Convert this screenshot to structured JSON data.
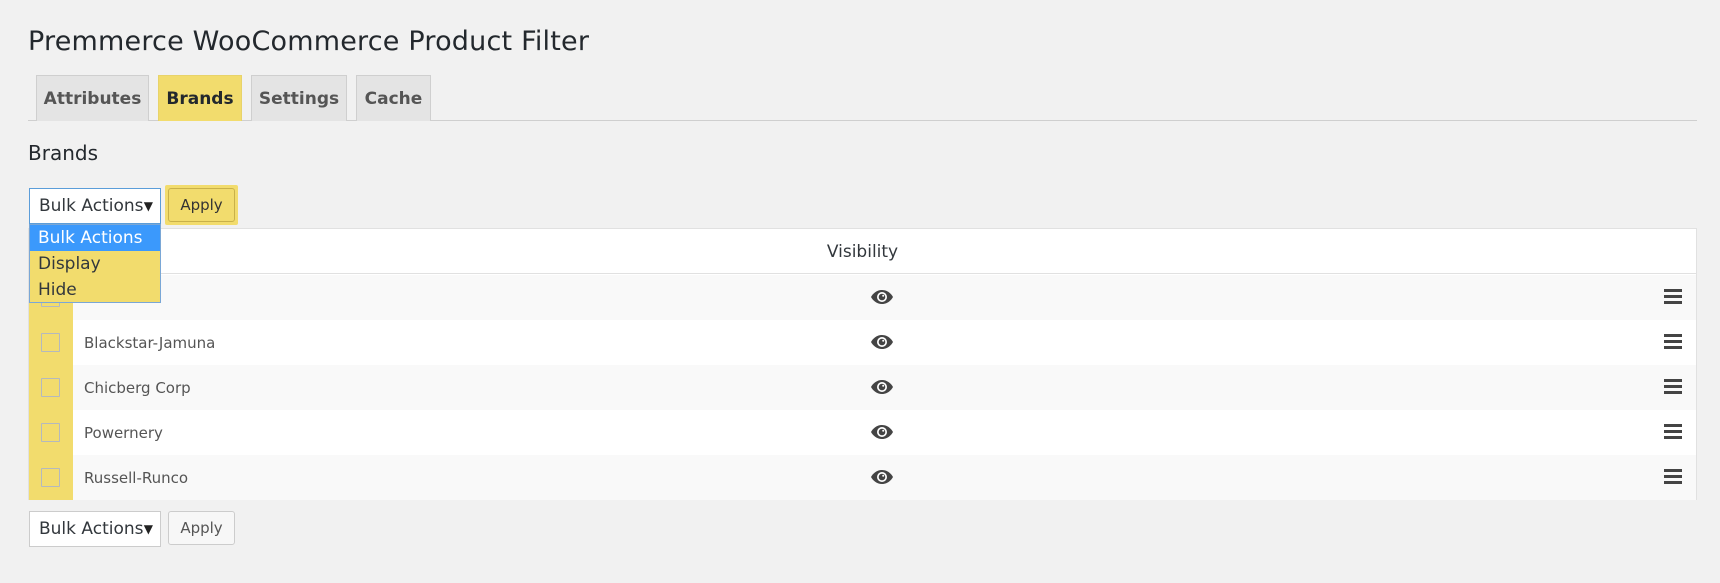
{
  "page": {
    "title": "Premmerce WooCommerce Product Filter"
  },
  "tabs": [
    {
      "label": "Attributes",
      "active": false
    },
    {
      "label": "Brands",
      "active": true
    },
    {
      "label": "Settings",
      "active": false
    },
    {
      "label": "Cache",
      "active": false
    }
  ],
  "section": {
    "title": "Brands"
  },
  "bulk_top": {
    "selected": "Bulk Actions",
    "apply_label": "Apply",
    "options": [
      "Bulk Actions",
      "Display",
      "Hide"
    ]
  },
  "table": {
    "header_visibility": "Visibility",
    "rows": [
      {
        "name": ""
      },
      {
        "name": "Blackstar-Jamuna"
      },
      {
        "name": "Chicberg Corp"
      },
      {
        "name": "Powernery"
      },
      {
        "name": "Russell-Runco"
      }
    ]
  },
  "bulk_bottom": {
    "selected": "Bulk Actions",
    "apply_label": "Apply"
  },
  "colors": {
    "highlight": "#f2dc6d",
    "selected_option": "#3b99fc",
    "background": "#f1f1f1"
  },
  "icons": {
    "visibility": "eye-icon",
    "drag": "drag-handle-icon",
    "dropdown": "caret-down-icon"
  }
}
